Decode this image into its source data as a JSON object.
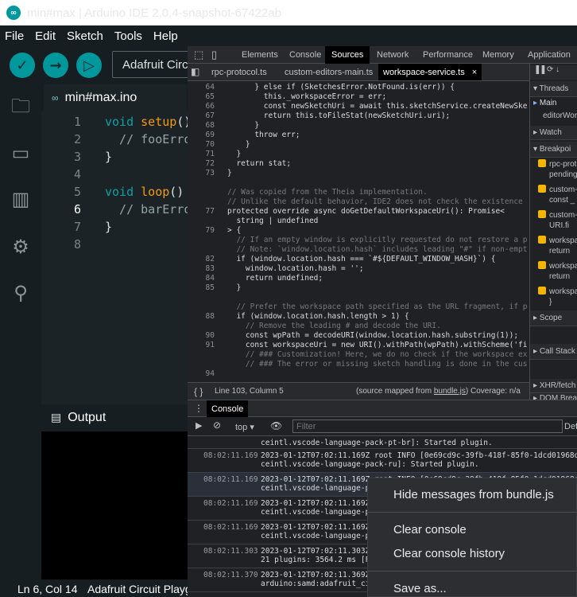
{
  "window": {
    "title": "min#max | Arduino IDE 2.0.4-snapshot-67422ab"
  },
  "menu": [
    "File",
    "Edit",
    "Sketch",
    "Tools",
    "Help"
  ],
  "toolbar": {
    "board": "Adafruit Circuit Playground"
  },
  "editor": {
    "tab": "min#max.ino",
    "lines": [
      "1",
      "2",
      "3",
      "4",
      "5",
      "6",
      "7",
      "8"
    ],
    "code": [
      {
        "a": "void",
        "b": " setup",
        "c": "()"
      },
      {
        "a": "",
        "b": "",
        "c": "  // fooError"
      },
      {
        "a": "",
        "b": "",
        "c": "}"
      },
      {
        "a": "",
        "b": "",
        "c": ""
      },
      {
        "a": "void",
        "b": " loop",
        "c": "()"
      },
      {
        "a": "",
        "b": "",
        "c": "  // barError"
      },
      {
        "a": "",
        "b": "",
        "c": "}"
      },
      {
        "a": "",
        "b": "",
        "c": ""
      }
    ]
  },
  "output": {
    "title": "Output"
  },
  "status": {
    "position": "Ln 6, Col 14",
    "board": "Adafruit Circuit Playground"
  },
  "devtools": {
    "tabs": [
      "Elements",
      "Console",
      "Sources",
      "Network",
      "Performance",
      "Memory",
      "Application"
    ],
    "active_tab": "Sources",
    "files": [
      "rpc-protocol.ts",
      "custom-editors-main.ts",
      "workspace-service.ts"
    ],
    "close": "×",
    "code_status": {
      "pos": "Line 103, Column 5",
      "mapped": "(source mapped from ",
      "bundle": "bundle.js",
      "coverage": ") Coverage: n/a"
    },
    "code_lines": [
      {
        "n": "64",
        "t": "      } else if (SketchesError.NotFound.is(err)) {"
      },
      {
        "n": "65",
        "t": "        this._workspaceError = err;"
      },
      {
        "n": "66",
        "t": "        const newSketchUri = await this.sketchService.createNewSke"
      },
      {
        "n": "67",
        "t": "        return this.toFileStat(newSketchUri.uri);"
      },
      {
        "n": "68",
        "t": "      }"
      },
      {
        "n": "69",
        "t": "      throw err;"
      },
      {
        "n": "70",
        "t": "    }"
      },
      {
        "n": "71",
        "t": "  }"
      },
      {
        "n": "72",
        "t": "  return stat;"
      },
      {
        "n": "73",
        "t": "}"
      },
      {
        "n": "",
        "t": ""
      },
      {
        "n": "",
        "t": "// Was copied from the Theia implementation."
      },
      {
        "n": "",
        "t": "// Unlike the default behavior, IDE2 does not check the existence"
      },
      {
        "n": "77",
        "t": "protected override async doGetDefaultWorkspaceUri(): Promise<"
      },
      {
        "n": "",
        "t": "  string | undefined"
      },
      {
        "n": "79",
        "t": "> {"
      },
      {
        "n": "",
        "t": "  // If an empty window is explicitly requested do not restore a p"
      },
      {
        "n": "",
        "t": "  // Note: `window.location.hash` includes leading \"#\" if non-empt"
      },
      {
        "n": "82",
        "t": "  if (window.location.hash === `#${DEFAULT_WINDOW_HASH}`) {"
      },
      {
        "n": "83",
        "t": "    window.location.hash = '';"
      },
      {
        "n": "84",
        "t": "    return undefined;"
      },
      {
        "n": "85",
        "t": "  }"
      },
      {
        "n": "",
        "t": ""
      },
      {
        "n": "",
        "t": "  // Prefer the workspace path specified as the URL fragment, if p"
      },
      {
        "n": "88",
        "t": "  if (window.location.hash.length > 1) {"
      },
      {
        "n": "",
        "t": "    // Remove the leading # and decode the URI."
      },
      {
        "n": "90",
        "t": "    const wpPath = decodeURI(window.location.hash.substring(1));"
      },
      {
        "n": "91",
        "t": "    const workspaceUri = new URI().withPath(wpPath).withScheme('fi"
      },
      {
        "n": "",
        "t": "    // ### Customization! Here, we do no check if the workspace ex"
      },
      {
        "n": "",
        "t": "    // ### The error or missing sketch handling is done in the cus"
      },
      {
        "n": "94",
        "t": ""
      }
    ],
    "right": {
      "threads": "Threads",
      "main": "Main",
      "editor": "editorWor",
      "watch": "Watch",
      "breakpoints": "Breakpoi",
      "bps": [
        {
          "a": "rpc-prot",
          "b": "pending"
        },
        {
          "a": "custom-",
          "b": "const _"
        },
        {
          "a": "custom-",
          "b": "URI.fi"
        },
        {
          "a": "workspa",
          "b": "return"
        },
        {
          "a": "workspa",
          "b": "return"
        },
        {
          "a": "workspa",
          "b": "}"
        }
      ],
      "scope": "Scope",
      "callstack": "Call Stack",
      "xhr": "XHR/fetch",
      "dom": "DOM Brea"
    },
    "console_tab": "Console",
    "context": "top",
    "filter_placeholder": "Filter",
    "levels": "Def",
    "logs": [
      {
        "ts": "",
        "m": "ceintl.vscode-language-pack-pt-br]: Started plugin."
      },
      {
        "ts": "08:02:11.169",
        "m": "2023-01-12T07:02:11.169Z root INFO [0e69cd9c-39fb-418f-85f0-1dcd01968d15\nceintl.vscode-language-pack-ru]: Started plugin."
      },
      {
        "ts": "08:02:11.169",
        "m": "2023-01-12T07:02:11.169Z root INFO [0e69cd9c-39fb-418f-85f0-1dcd01968d15\nceintl.vscode-language-pa"
      },
      {
        "ts": "08:02:11.169",
        "m": "2023-01-12T07:02:11.169Z\nceintl.vscode-language-pa"
      },
      {
        "ts": "08:02:11.169",
        "m": "2023-01-12T07:02:11.169Z\nceintl.vscode-language-pa"
      },
      {
        "ts": "08:02:11.303",
        "m": "2023-01-12T07:02:11.303Z\n21 plugins: 3564.2 ms [Fi"
      },
      {
        "ts": "08:02:11.370",
        "m": "2023-01-12T07:02:11.369Z\narduino:samd:adafruit_cir"
      }
    ]
  },
  "context_menu": {
    "hide": "Hide messages from bundle.js",
    "clear": "Clear console",
    "clear_history": "Clear console history",
    "save": "Save as..."
  }
}
